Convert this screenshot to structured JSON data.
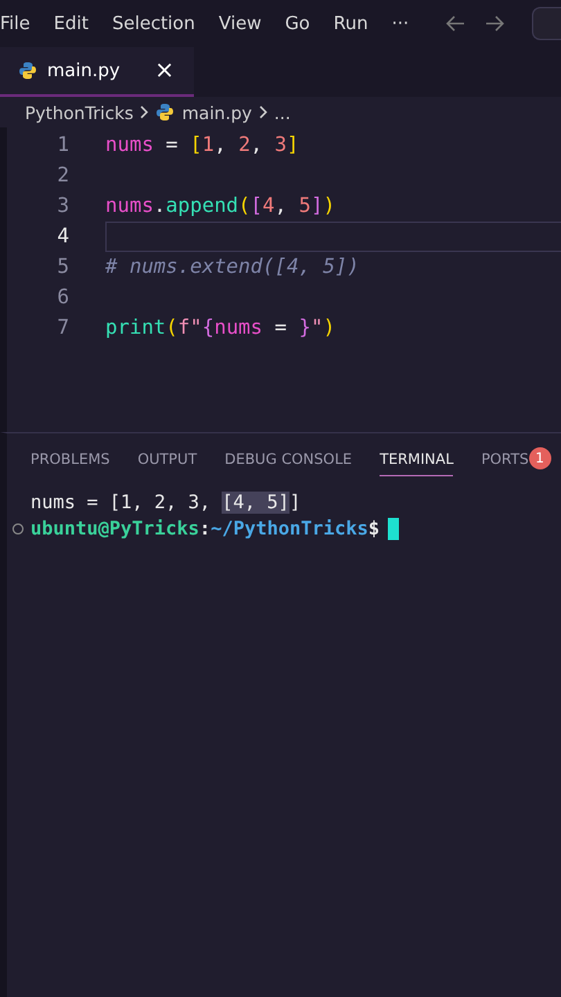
{
  "menu_bar": {
    "items": [
      "File",
      "Edit",
      "Selection",
      "View",
      "Go",
      "Run",
      "···"
    ]
  },
  "tabs": [
    {
      "label": "main.py",
      "selected": true,
      "close": "×"
    }
  ],
  "breadcrumb": [
    "PythonTricks",
    "main.py",
    "..."
  ],
  "editor": {
    "lines": [
      {
        "number": "1",
        "current": false,
        "tokens": [
          {
            "text": "nums",
            "kind": "var"
          },
          {
            "text": " = ",
            "kind": "op"
          },
          {
            "text": "[",
            "kind": "b1"
          },
          {
            "text": "1",
            "kind": "num"
          },
          {
            "text": ", ",
            "kind": "op"
          },
          {
            "text": "2",
            "kind": "num"
          },
          {
            "text": ", ",
            "kind": "op"
          },
          {
            "text": "3",
            "kind": "num"
          },
          {
            "text": "]",
            "kind": "b1"
          }
        ]
      },
      {
        "number": "2",
        "current": false
      },
      {
        "number": "3",
        "current": false,
        "tokens": [
          {
            "text": "nums",
            "kind": "var"
          },
          {
            "text": ".",
            "kind": "op"
          },
          {
            "text": "append",
            "kind": "func"
          },
          {
            "text": "(",
            "kind": "b1"
          },
          {
            "text": "[",
            "kind": "b2"
          },
          {
            "text": "4",
            "kind": "num"
          },
          {
            "text": ", ",
            "kind": "op"
          },
          {
            "text": "5",
            "kind": "num"
          },
          {
            "text": "]",
            "kind": "b2"
          },
          {
            "text": ")",
            "kind": "b1"
          }
        ]
      },
      {
        "number": "4",
        "current": true
      },
      {
        "number": "5",
        "current": false,
        "tokens": [
          {
            "text": "# nums.extend([4, 5])",
            "kind": "comment"
          }
        ]
      },
      {
        "number": "6",
        "current": false
      },
      {
        "number": "7",
        "current": false,
        "tokens": [
          {
            "text": "print",
            "kind": "func"
          },
          {
            "text": "(",
            "kind": "b1"
          },
          {
            "text": "f\"",
            "kind": "str"
          },
          {
            "text": "{",
            "kind": "b2"
          },
          {
            "text": "nums",
            "kind": "var"
          },
          {
            "text": " = ",
            "kind": "op"
          },
          {
            "text": "}",
            "kind": "b2"
          },
          {
            "text": "\"",
            "kind": "str"
          },
          {
            "text": ")",
            "kind": "b1"
          }
        ]
      }
    ]
  },
  "panel_tabs": [
    {
      "label": "PROBLEMS",
      "selected": false
    },
    {
      "label": "OUTPUT",
      "selected": false
    },
    {
      "label": "DEBUG CONSOLE",
      "selected": false
    },
    {
      "label": "TERMINAL",
      "selected": true
    },
    {
      "label": "PORTS",
      "selected": false,
      "badge": "1"
    }
  ],
  "terminal": {
    "output": [
      {
        "text": "nums = [1, 2, 3, ",
        "highlighted": false
      },
      {
        "text": "[4, 5]",
        "highlighted": true
      },
      {
        "text": "]",
        "highlighted": false
      }
    ],
    "prompt": {
      "user_host": "ubuntu@PyTricks",
      "separator": ":",
      "path": "~/PythonTricks",
      "symbol": "$"
    }
  }
}
